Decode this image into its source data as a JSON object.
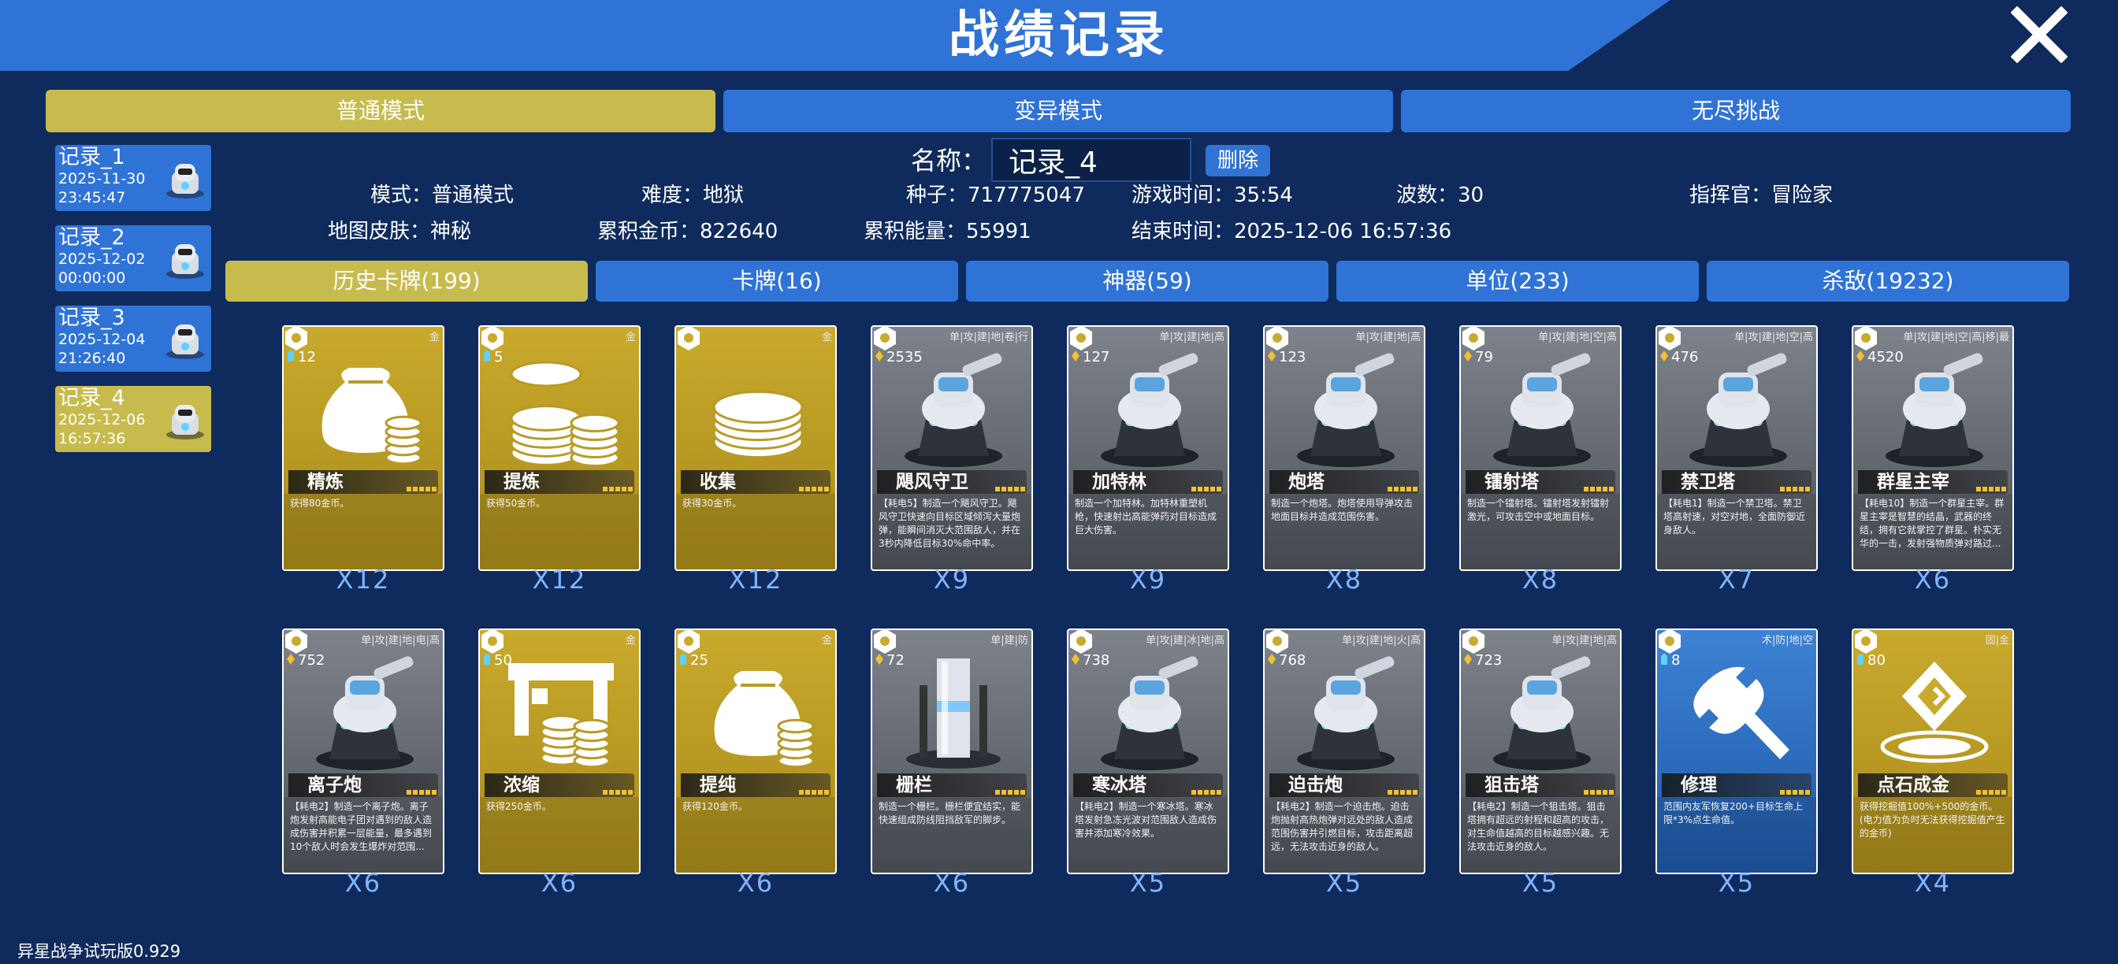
{
  "header": {
    "title": "战绩记录"
  },
  "modes": [
    {
      "label": "普通模式",
      "active": true
    },
    {
      "label": "变异模式",
      "active": false
    },
    {
      "label": "无尽挑战",
      "active": false
    }
  ],
  "records": [
    {
      "name": "记录_1",
      "date": "2025-11-30",
      "time": "23:45:47",
      "active": false
    },
    {
      "name": "记录_2",
      "date": "2025-12-02",
      "time": "00:00:00",
      "active": false
    },
    {
      "name": "记录_3",
      "date": "2025-12-04",
      "time": "21:26:40",
      "active": false
    },
    {
      "name": "记录_4",
      "date": "2025-12-06",
      "time": "16:57:36",
      "active": true
    }
  ],
  "detail": {
    "name_label": "名称：",
    "name_value": "记录_4",
    "delete_label": "删除",
    "row1": [
      {
        "label": "模式：",
        "value": "普通模式"
      },
      {
        "label": "难度：",
        "value": "地狱"
      },
      {
        "label": "种子：",
        "value": "717775047"
      },
      {
        "label": "游戏时间：",
        "value": "35:54"
      },
      {
        "label": "波数：",
        "value": "30"
      },
      {
        "label": "指挥官：",
        "value": "冒险家"
      }
    ],
    "row2": [
      {
        "label": "地图皮肤：",
        "value": "神秘"
      },
      {
        "label": "累积金币：",
        "value": "822640"
      },
      {
        "label": "累积能量：",
        "value": "55991"
      },
      {
        "label": "结束时间：",
        "value": "2025-12-06 16:57:36"
      }
    ]
  },
  "categories": [
    {
      "label": "历史卡牌(199)",
      "active": true
    },
    {
      "label": "卡牌(16)",
      "active": false
    },
    {
      "label": "神器(59)",
      "active": false
    },
    {
      "label": "单位(233)",
      "active": false
    },
    {
      "label": "杀敌(19232)",
      "active": false
    }
  ],
  "cards": [
    {
      "name": "精炼",
      "cost": "12",
      "cost_type": "energy",
      "tag": "金",
      "style": "gold",
      "art": "bag-coins",
      "desc": "获得80金币。",
      "count": "X12"
    },
    {
      "name": "提炼",
      "cost": "5",
      "cost_type": "energy",
      "tag": "金",
      "style": "gold",
      "art": "coin-stacks",
      "desc": "获得50金币。",
      "count": "X12"
    },
    {
      "name": "收集",
      "cost": "",
      "cost_type": "none",
      "tag": "金",
      "style": "gold",
      "art": "coin-stack",
      "desc": "获得30金币。",
      "count": "X12"
    },
    {
      "name": "飓风守卫",
      "cost": "2535",
      "cost_type": "gold",
      "tag": "单|攻|建|地|卷|行",
      "style": "grey",
      "art": "turret",
      "desc": "【耗电5】制造一个飓风守卫。飓风守卫快速向目标区域倾泻大量炮弹，能瞬间消灭大范围敌人，并在3秒内降低目标30%命中率。",
      "count": "X9"
    },
    {
      "name": "加特林",
      "cost": "127",
      "cost_type": "gold",
      "tag": "单|攻|建|地|高",
      "style": "grey",
      "art": "turret",
      "desc": "制造一个加特林。加特林重塑机枪，快速射出高能弹药对目标造成巨大伤害。",
      "count": "X9"
    },
    {
      "name": "炮塔",
      "cost": "123",
      "cost_type": "gold",
      "tag": "单|攻|建|地|高",
      "style": "grey",
      "art": "turret",
      "desc": "制造一个炮塔。炮塔使用导弹攻击地面目标并造成范围伤害。",
      "count": "X8"
    },
    {
      "name": "镭射塔",
      "cost": "79",
      "cost_type": "gold",
      "tag": "单|攻|建|地|空|高",
      "style": "grey",
      "art": "turret",
      "desc": "制造一个镭射塔。镭射塔发射镭射激光，可攻击空中或地面目标。",
      "count": "X8"
    },
    {
      "name": "禁卫塔",
      "cost": "476",
      "cost_type": "gold",
      "tag": "单|攻|建|地|空|高",
      "style": "grey",
      "art": "turret",
      "desc": "【耗电1】制造一个禁卫塔。禁卫塔高射速，对空对地，全面防御近身敌人。",
      "count": "X7"
    },
    {
      "name": "群星主宰",
      "cost": "4520",
      "cost_type": "gold",
      "tag": "单|攻|建|地|空|高|移|最",
      "style": "grey",
      "art": "turret",
      "desc": "【耗电10】制造一个群星主宰。群星主宰是智慧的结晶，武器的终结，拥有它就掌控了群星。朴实无华的一击，发射强物质弹对路过...",
      "count": "X6"
    },
    {
      "name": "离子炮",
      "cost": "752",
      "cost_type": "gold",
      "tag": "单|攻|建|地|电|高",
      "style": "grey",
      "art": "turret",
      "desc": "【耗电2】制造一个离子炮。离子炮发射高能电子团对遇到的敌人造成伤害并积累一层能量，最多遇到10个敌人时会发生爆炸对范围...",
      "count": "X6"
    },
    {
      "name": "浓缩",
      "cost": "50",
      "cost_type": "energy",
      "tag": "金",
      "style": "gold",
      "art": "press-coins",
      "desc": "获得250金币。",
      "count": "X6"
    },
    {
      "name": "提纯",
      "cost": "25",
      "cost_type": "energy",
      "tag": "金",
      "style": "gold",
      "art": "bag-coins",
      "desc": "获得120金币。",
      "count": "X6"
    },
    {
      "name": "栅栏",
      "cost": "72",
      "cost_type": "gold",
      "tag": "单|建|防",
      "style": "grey",
      "art": "pillar",
      "desc": "制造一个栅栏。栅栏便宜结实，能快速组成防线阻挡敌军的脚步。",
      "count": "X6"
    },
    {
      "name": "寒冰塔",
      "cost": "738",
      "cost_type": "gold",
      "tag": "单|攻|建|冰|地|高",
      "style": "grey",
      "art": "turret",
      "desc": "【耗电2】制造一个寒冰塔。寒冰塔发射急冻光波对范围敌人造成伤害并添加寒冷效果。",
      "count": "X5"
    },
    {
      "name": "迫击炮",
      "cost": "768",
      "cost_type": "gold",
      "tag": "单|攻|建|地|火|高",
      "style": "grey",
      "art": "turret",
      "desc": "【耗电2】制造一个迫击炮。迫击炮抛射高热炮弹对远处的敌人造成范围伤害并引燃目标，攻击距离超远，无法攻击近身的敌人。",
      "count": "X5"
    },
    {
      "name": "狙击塔",
      "cost": "723",
      "cost_type": "gold",
      "tag": "单|攻|建|地|高",
      "style": "grey",
      "art": "turret",
      "desc": "【耗电2】制造一个狙击塔。狙击塔拥有超远的射程和超高的攻击，对生命值越高的目标越感兴趣。无法攻击近身的敌人。",
      "count": "X5"
    },
    {
      "name": "修理",
      "cost": "8",
      "cost_type": "energy",
      "tag": "术|防|地|空",
      "style": "blue",
      "art": "wrench",
      "desc": "范围内友军恢复200+目标生命上限*3%点生命值。",
      "count": "X5"
    },
    {
      "name": "点石成金",
      "cost": "80",
      "cost_type": "energy",
      "tag": "固|金",
      "style": "gold",
      "art": "gold-emblem",
      "desc": "获得挖掘值100%+500的金币。(电力值为负时无法获得挖掘值产生的金币)",
      "count": "X4"
    }
  ],
  "footer": {
    "version": "异星战争试玩版0.929"
  },
  "colors": {
    "accent": "#2f73d6",
    "active": "#c7bb4d",
    "background": "#0f2a5c",
    "count": "#7fb4ff"
  }
}
